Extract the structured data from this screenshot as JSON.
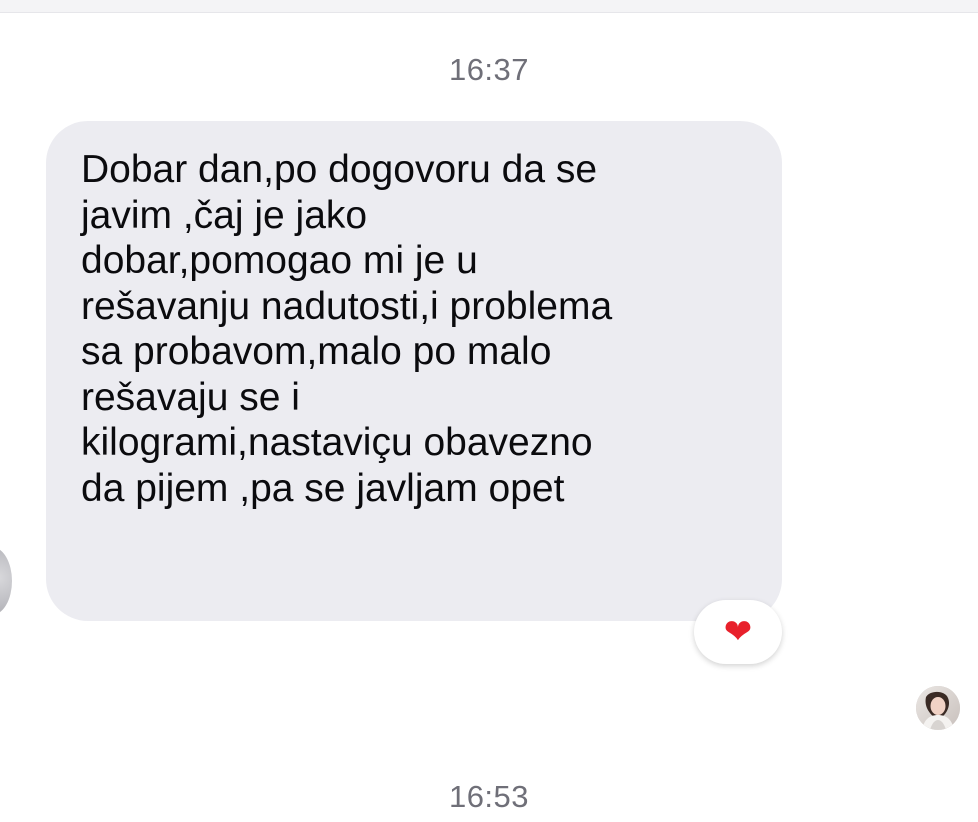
{
  "chat": {
    "timestamps": [
      "16:37",
      "16:53"
    ],
    "message": {
      "text": "Dobar dan,po dogovoru da se\njavim ,čaj je jako\ndobar,pomogao mi je u\nrešavanju nadutosti,i problema\nsa probavom,malo po malo\nrešavaju se i\nkilogrami,nastaviçu obavezno\nda pijem ,pa se javljam opet",
      "reaction": "❤"
    },
    "icons": {
      "reaction": "heart-reaction-icon",
      "seen": "seen-avatar-icon"
    }
  },
  "colors": {
    "bubble_background": "#ececf1",
    "timestamp_text": "#6f6f78",
    "message_text": "#0b0b0e",
    "reaction_heart": "#e8202b"
  }
}
